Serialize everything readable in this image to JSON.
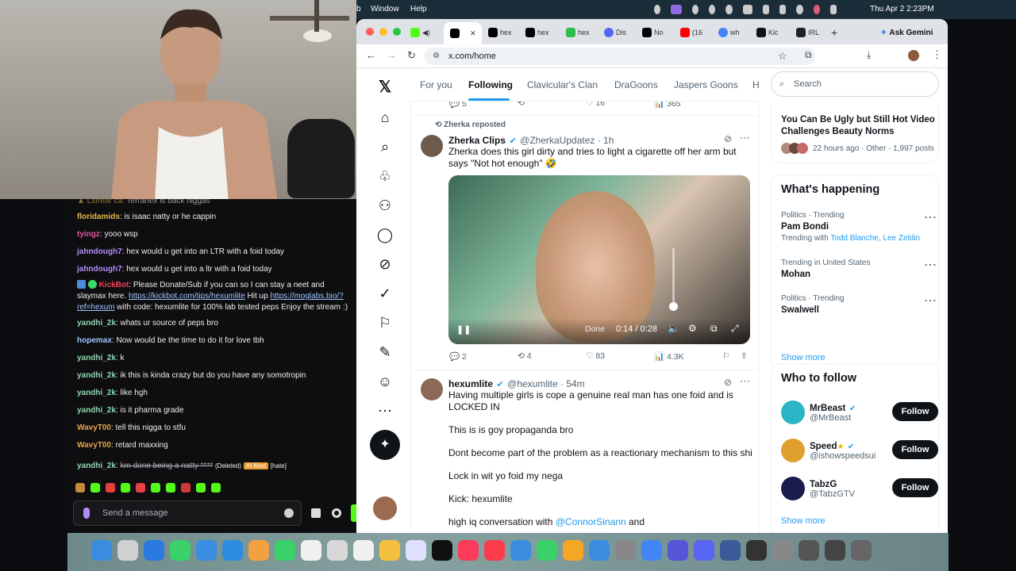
{
  "menubar": {
    "items": [
      "b",
      "Window",
      "Help"
    ],
    "clock": "Thu Apr 2  2:23PM"
  },
  "browser": {
    "tabs": [
      {
        "label": "hex"
      },
      {
        "label": "hex"
      },
      {
        "label": "hex"
      },
      {
        "label": "Dis"
      },
      {
        "label": "No"
      },
      {
        "label": "(16"
      },
      {
        "label": "wh"
      },
      {
        "label": "Kic"
      },
      {
        "label": "IRL"
      }
    ],
    "ask_gemini": "Ask Gemini",
    "url": "x.com/home"
  },
  "x": {
    "tabs": [
      "For you",
      "Following",
      "Clavicular's Clan",
      "DraGoons",
      "Jaspers Goons",
      "H"
    ],
    "active_tab": "Following",
    "top_stats": {
      "replies": "5",
      "likes": "16",
      "views": "365"
    },
    "post1": {
      "repost": "Zherka reposted",
      "name": "Zherka Clips",
      "handle": "@ZherkaUpdatez · 1h",
      "text": "Zherka does this girl dirty and tries to light a cigarette off her arm but says \"Not hot enough\" 🤣",
      "video_time": "0:14 / 0:28",
      "video_label": "Done",
      "replies": "2",
      "reposts": "4",
      "likes": "83",
      "views": "4.3K"
    },
    "post2": {
      "name": "hexumlite",
      "handle": "@hexumlite · 54m",
      "lines": [
        "Having multiple girls is cope a genuine real man has one foid and is LOCKED IN",
        "This is is goy propaganda bro",
        "Dont become part of the problem as a reactionary mechanism to this shi",
        "Lock in wit yo foid my nega",
        "Kick: hexumlite"
      ],
      "last_prefix": "high iq conversation with ",
      "last_mention": "@ConnorSinann",
      "last_suffix": " and"
    },
    "search_placeholder": "Search",
    "trend_card": {
      "title": "You Can Be Ugly but Still Hot Video Challenges Beauty Norms",
      "meta": "22 hours ago · Other · 1,997 posts"
    },
    "happening": {
      "title": "What's happening",
      "items": [
        {
          "cat": "Politics · Trending",
          "name": "Pam Bondi",
          "with_prefix": "Trending with ",
          "with_a": "Todd Blanche",
          "with_sep": ", ",
          "with_b": "Lee Zeldin"
        },
        {
          "cat": "Trending in United States",
          "name": "Mohan"
        },
        {
          "cat": "Politics · Trending",
          "name": "Swalwell"
        }
      ],
      "show_more": "Show more"
    },
    "who_to_follow": {
      "title": "Who to follow",
      "people": [
        {
          "name": "MrBeast",
          "handle": "@MrBeast",
          "button": "Follow"
        },
        {
          "name": "Speed",
          "handle": "@ishowspeedsui",
          "button": "Follow"
        },
        {
          "name": "TabzG",
          "handle": "@TabzGTV",
          "button": "Follow"
        }
      ],
      "show_more": "Show more"
    }
  },
  "chat": {
    "messages": [
      {
        "user": "floridamids",
        "text": " is isaac natty or he cappin",
        "color": "#e6b84a"
      },
      {
        "user": "tyingz",
        "text": " yooo wsp",
        "color": "#e0569a"
      },
      {
        "user": "jahndough7",
        "text": " hex would u get into an LTR with a foid today",
        "color": "#b28cf5"
      },
      {
        "user": "jahndough7",
        "text": " hex would u get into a ltr with a foid today",
        "color": "#b28cf5"
      },
      {
        "user": "yandhi_2k",
        "text": " whats ur source of peps bro",
        "color": "#8fd6b0"
      },
      {
        "user": "hopemax",
        "text": " Now would be the time to do it for love tbh",
        "color": "#9ec5ff"
      },
      {
        "user": "yandhi_2k",
        "text": " k",
        "color": "#8fd6b0"
      },
      {
        "user": "yandhi_2k",
        "text": " ik this is kinda crazy but do you have any somotropin",
        "color": "#8fd6b0"
      },
      {
        "user": "yandhi_2k",
        "text": " like hgh",
        "color": "#8fd6b0"
      },
      {
        "user": "yandhi_2k",
        "text": " is it pharma grade",
        "color": "#8fd6b0"
      },
      {
        "user": "WavyT00",
        "text": " tell this nigga to stfu",
        "color": "#e8a34a"
      },
      {
        "user": "WavyT00",
        "text": " retard maxxing",
        "color": "#e8a34a"
      }
    ],
    "bot": {
      "user": "KickBot",
      "text": " Please Donate/Sub if you can so I can stay a neet and slaymax here. ",
      "link1": "https://kickbot.com/tips/hexumlite",
      "mid": " Hit up ",
      "link2": "https://moglabs.bio/?ref=hexum",
      "tail": " with code: hexumlite for 100% lab tested peps Enjoy the stream :)"
    },
    "deleted": {
      "user": "yandhi_2k",
      "text": "km done being a natty ****",
      "tag": "(Deleted)",
      "badge": "AI Mod",
      "hate": "[hate]"
    },
    "input_placeholder": "Send a message"
  },
  "colors": {
    "x_blue": "#1d9bf0",
    "kick_green": "#53fc18"
  }
}
